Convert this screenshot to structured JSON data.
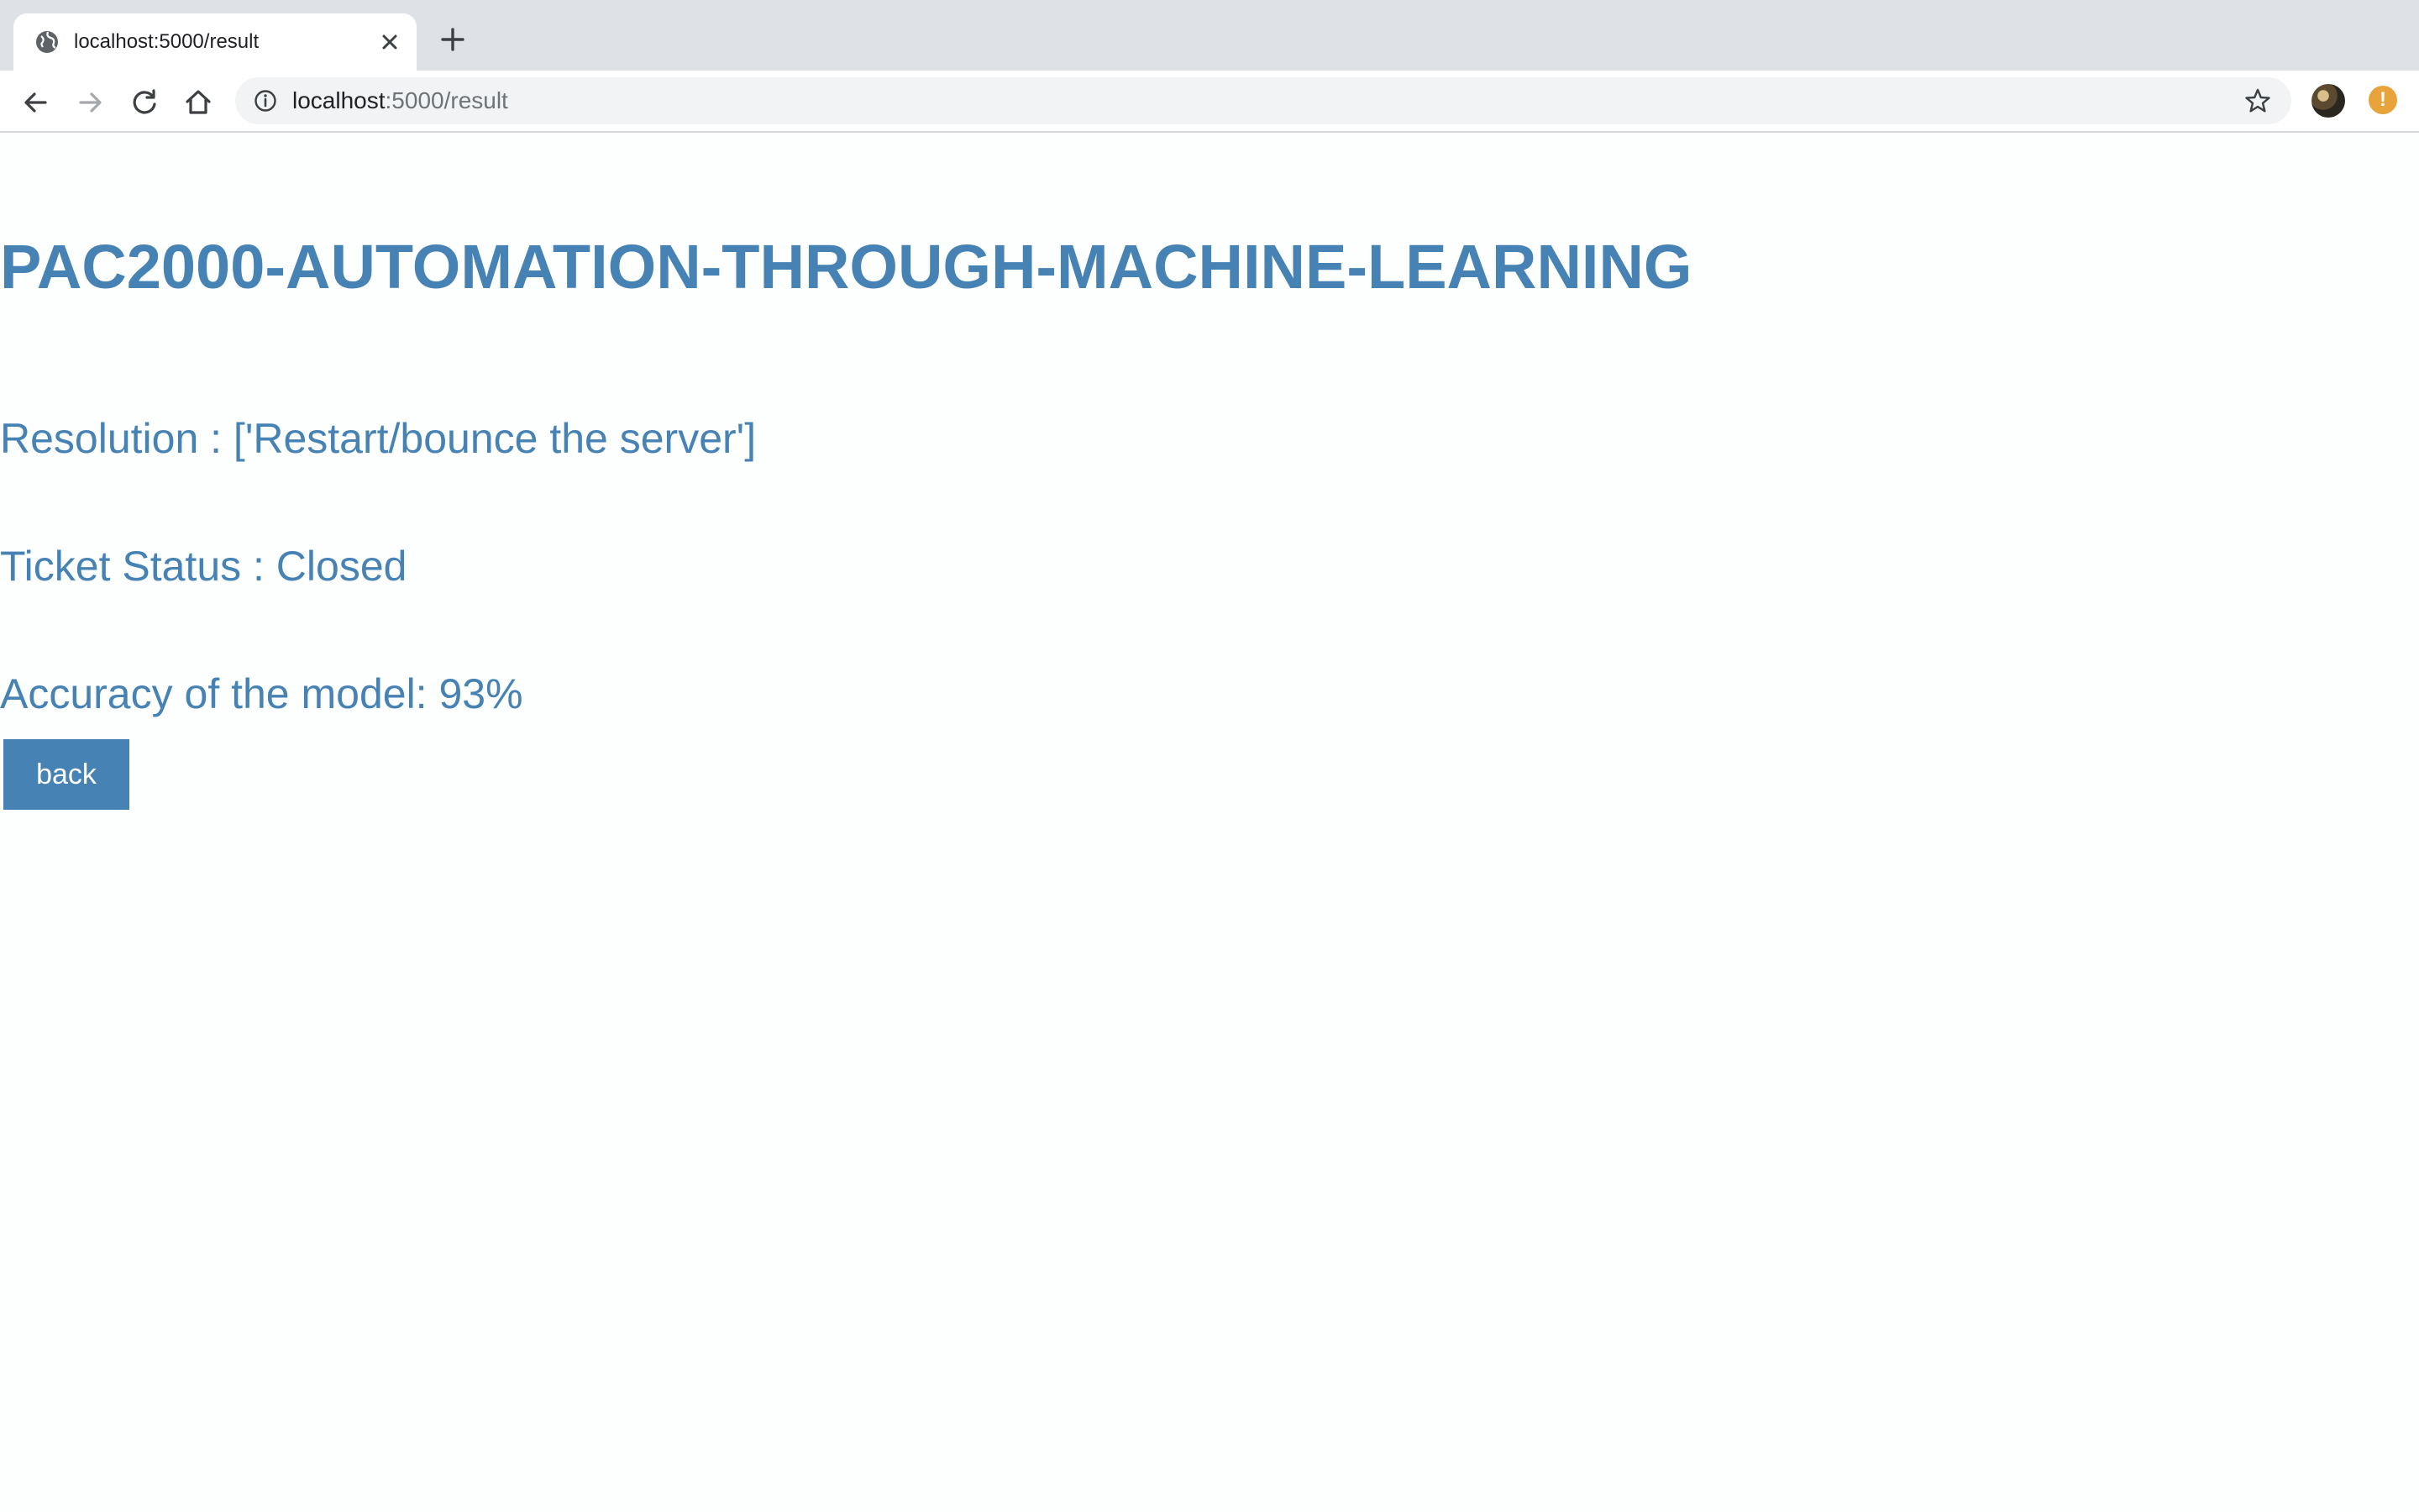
{
  "browser": {
    "tab": {
      "title": "localhost:5000/result"
    },
    "address_bar": {
      "host": "localhost",
      "rest": ":5000/result"
    }
  },
  "page": {
    "title": "PAC2000-AUTOMATION-THROUGH-MACHINE-LEARNING",
    "resolution": "Resolution : ['Restart/bounce the server']",
    "ticket_status": "Ticket Status : Closed",
    "accuracy": "Accuracy of the model: 93%",
    "back_label": "back"
  },
  "colors": {
    "accent": "#4682b4",
    "alert": "#e8a33a"
  },
  "icons": [
    "globe-icon",
    "close-icon",
    "plus-icon",
    "back-arrow-icon",
    "forward-arrow-icon",
    "reload-icon",
    "home-icon",
    "info-icon",
    "star-icon",
    "profile-avatar",
    "alert-icon"
  ]
}
